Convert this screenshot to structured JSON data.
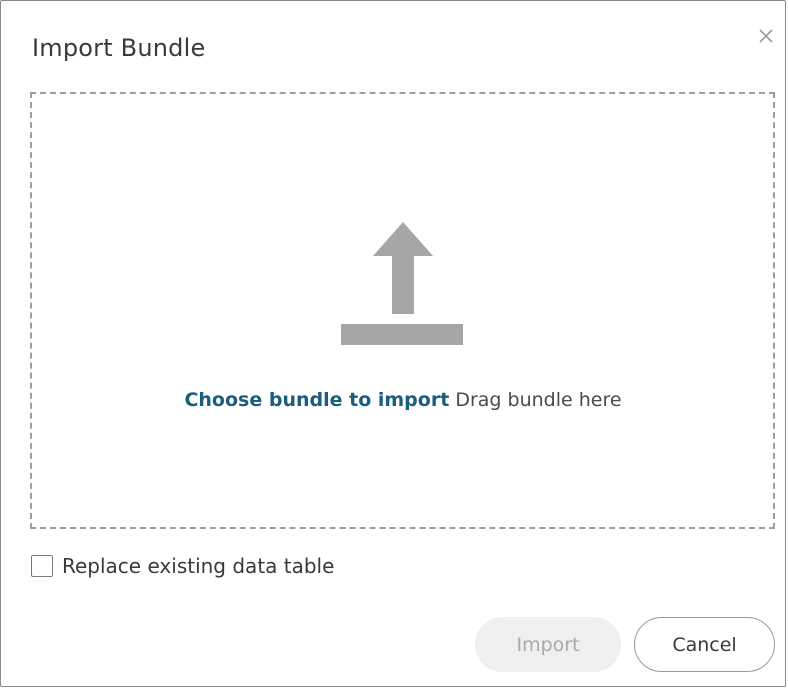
{
  "dialog": {
    "title": "Import Bundle"
  },
  "dropzone": {
    "link_text": "Choose bundle to import",
    "hint_text": "Drag bundle here",
    "icon": "upload-icon"
  },
  "options": {
    "replace_label": "Replace existing data table",
    "replace_checked": false
  },
  "footer": {
    "import_label": "Import",
    "cancel_label": "Cancel"
  },
  "colors": {
    "link": "#1b5d7c",
    "icon": "#a6a6a6",
    "import_disabled_bg": "#efefef",
    "import_disabled_text": "#a9a9a9"
  }
}
